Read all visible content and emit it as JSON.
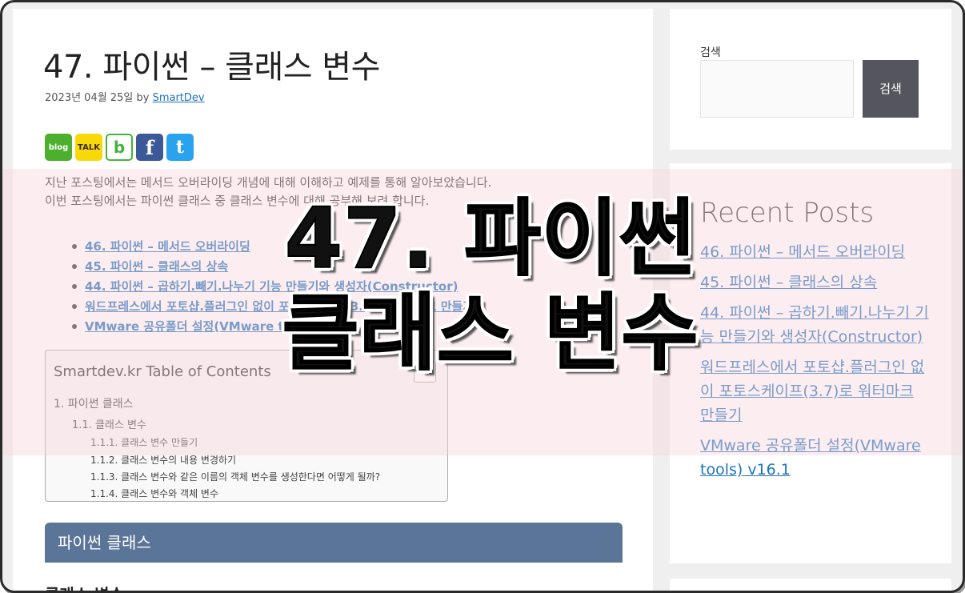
{
  "post": {
    "title": "47. 파이썬 – 클래스 변수",
    "date": "2023년 04월 25일",
    "by": "by",
    "author": "SmartDev",
    "share_icons": [
      {
        "name": "blog-icon",
        "label": "blog"
      },
      {
        "name": "kakaotalk-icon",
        "label": "TALK"
      },
      {
        "name": "band-icon",
        "label": "b"
      },
      {
        "name": "facebook-icon",
        "label": "f"
      },
      {
        "name": "twitter-icon",
        "label": "t"
      }
    ],
    "intro": [
      "지난 포스팅에서는 메서드 오버라이딩 개념에 대해 이해하고 예제를 통해 알아보았습니다.",
      "이번 포스팅에서는 파이썬 클래스 중 클래스 변수에 대해 공부해 보려 합니다."
    ],
    "related": [
      "46. 파이썬 – 메서드 오버라이딩",
      "45. 파이썬 – 클래스의 상속",
      "44. 파이썬 – 곱하기.빼기.나누기 기능 만들기와 생성자(Constructor)",
      "워드프레스에서 포토샵.플러그인 없이 포토스케이프(3.7)로 워터마크 만들기",
      "VMware 공유폴더 설정(VMware tools) v16.1"
    ]
  },
  "toc": {
    "header": "Smartdev.kr Table of Contents",
    "items": [
      "1. 파이썬 클래스",
      "1.1. 클래스 변수",
      "1.1.1. 클래스 변수 만들기",
      "1.1.2. 클래스 변수의 내용 변경하기",
      "1.1.3. 클래스 변수와 같은 이름의 객체 변수를 생성한다면 어떻게 될까?",
      "1.1.4. 클래스 변수와 객체 변수"
    ]
  },
  "content": {
    "section_heading": "파이썬 클래스",
    "sub_heading": "클래스 변수"
  },
  "sidebar": {
    "search_label": "검색",
    "search_placeholder": "",
    "search_button": "검색",
    "recent_title": "Recent Posts",
    "recent_posts": [
      "46. 파이썬 – 메서드 오버라이딩",
      "45. 파이썬 – 클래스의 상속",
      "44. 파이썬 – 곱하기.빼기.나누기 기능 만들기와 생성자(Constructor)",
      "워드프레스에서 포토샵.플러그인 없이 포토스케이프(3.7)로 워터마크 만들기",
      "VMware 공유폴더 설정(VMware tools) v16.1"
    ]
  },
  "overlay": {
    "line1": "47. 파이썬",
    "line2": "클래스 변수"
  },
  "colors": {
    "link": "#1e73be",
    "section_heading_bg": "#5b7599",
    "search_button_bg": "#55555e",
    "overlay_band": "#f8d4dc"
  }
}
